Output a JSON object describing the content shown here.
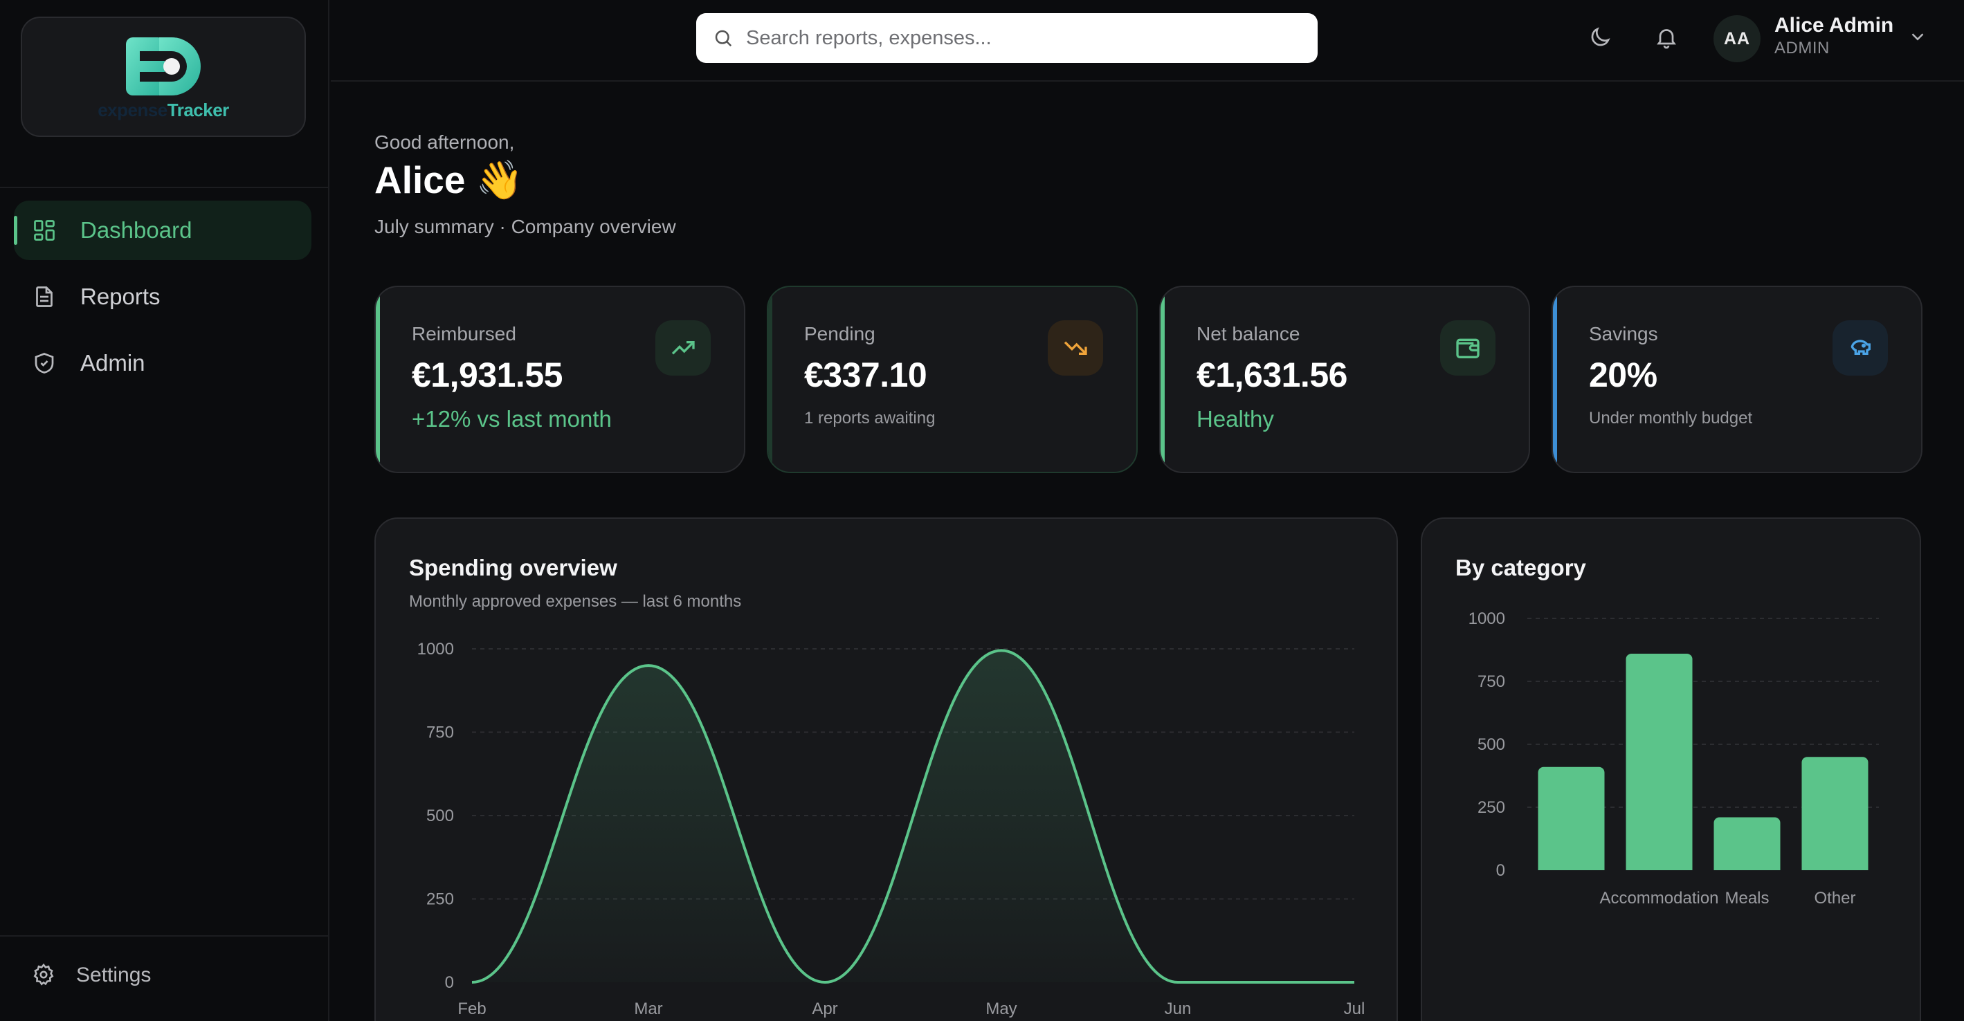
{
  "app": {
    "logo_part1": "expense",
    "logo_part2": "Tracker"
  },
  "sidebar": {
    "items": [
      {
        "label": "Dashboard",
        "icon": "grid-icon",
        "active": true
      },
      {
        "label": "Reports",
        "icon": "document-icon",
        "active": false
      },
      {
        "label": "Admin",
        "icon": "shield-check-icon",
        "active": false
      }
    ],
    "settings_label": "Settings"
  },
  "header": {
    "search_placeholder": "Search reports, expenses...",
    "user": {
      "initials": "AA",
      "name": "Alice Admin",
      "role": "ADMIN"
    }
  },
  "greeting": {
    "salutation": "Good afternoon,",
    "name": "Alice 👋",
    "subtitle": "July summary · Company overview"
  },
  "stats": [
    {
      "label": "Reimbursed",
      "value": "€1,931.55",
      "sub": "+12% vs last month",
      "sub_color": "#5bc48a",
      "accent": "#5bc48a",
      "icon": "trending-up-icon",
      "icon_color": "#5bc48a",
      "icon_bg": "#1c2a23"
    },
    {
      "label": "Pending",
      "value": "€337.10",
      "sub": "1 reports awaiting",
      "sub_color": "#9a9ba0",
      "accent": "#1f3a2d",
      "icon": "trending-down-icon",
      "icon_color": "#f0a43a",
      "icon_bg": "#2e2418"
    },
    {
      "label": "Net balance",
      "value": "€1,631.56",
      "sub": "Healthy",
      "sub_color": "#5bc48a",
      "accent": "#5bc48a",
      "icon": "wallet-icon",
      "icon_color": "#5bc48a",
      "icon_bg": "#1c2a23"
    },
    {
      "label": "Savings",
      "value": "20%",
      "sub": "Under monthly budget",
      "sub_color": "#9a9ba0",
      "accent": "#3d8fd6",
      "icon": "piggy-bank-icon",
      "icon_color": "#4aa3e6",
      "icon_bg": "#18232e"
    }
  ],
  "spending": {
    "title": "Spending overview",
    "subtitle": "Monthly approved expenses — last 6 months"
  },
  "category": {
    "title": "By category"
  },
  "chart_data": [
    {
      "type": "area",
      "title": "Spending overview",
      "x": [
        "Feb",
        "Mar",
        "Apr",
        "May",
        "Jun",
        "Jul"
      ],
      "values": [
        0,
        950,
        0,
        995,
        0,
        0
      ],
      "yticks": [
        0,
        250,
        500,
        750,
        1000
      ],
      "ylim": [
        0,
        1000
      ],
      "grid": true,
      "color": "#5bc48a"
    },
    {
      "type": "bar",
      "title": "By category",
      "categories": [
        "",
        "Accommodation",
        "Meals",
        "Other"
      ],
      "values": [
        410,
        860,
        210,
        450
      ],
      "yticks": [
        0,
        250,
        500,
        750,
        1000
      ],
      "ylim": [
        0,
        1000
      ],
      "grid": true,
      "color": "#5bc48a"
    }
  ]
}
